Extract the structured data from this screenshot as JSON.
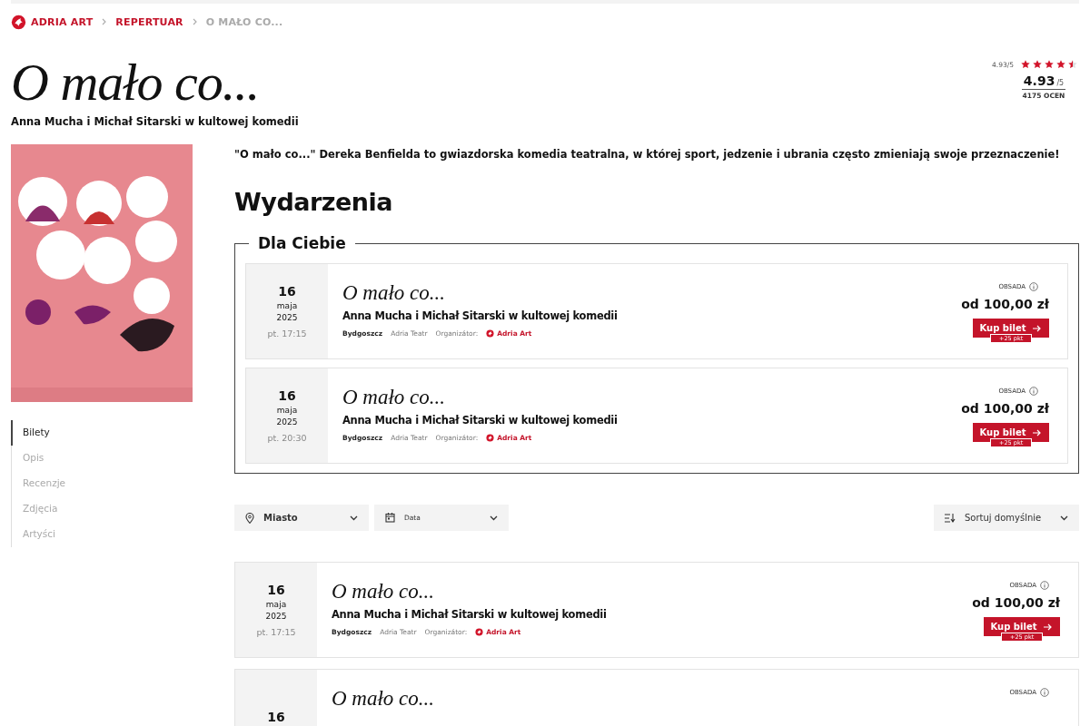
{
  "breadcrumb": [
    {
      "label": "ADRIA ART",
      "kind": "brand"
    },
    {
      "label": "REPERTUAR",
      "kind": "link"
    },
    {
      "label": "O MAŁO CO...",
      "kind": "current"
    }
  ],
  "title": "O mało co...",
  "subtitle": "Anna Mucha i Michał Sitarski w kultowej komedii",
  "rating": {
    "small": "4.93/5",
    "stars": 4.5,
    "value": "4.93",
    "out_of": "/5",
    "count": "4175 OCEN"
  },
  "side_nav": [
    {
      "label": "Bilety",
      "selected": true
    },
    {
      "label": "Opis",
      "selected": false
    },
    {
      "label": "Recenzje",
      "selected": false
    },
    {
      "label": "Zdjęcia",
      "selected": false
    },
    {
      "label": "Artyści",
      "selected": false
    }
  ],
  "description": "\"O mało co...\" Dereka Benfielda to gwiazdorska komedia teatralna, w której sport, jedzenie i ubrania często zmieniają swoje przeznaczenie!",
  "events_heading": "Wydarzenia",
  "for_you": {
    "legend": "Dla Ciebie",
    "events": [
      {
        "day": "16",
        "month": "maja",
        "year": "2025",
        "time": "pt. 17:15",
        "title": "O mało co...",
        "subtitle": "Anna Mucha i Michał Sitarski w kultowej komedii",
        "city": "Bydgoszcz",
        "venue": "Adria Teatr",
        "organizer_label": "Organizátor:",
        "organizer": "Adria Art",
        "cast_label": "OBSADA",
        "price": "od 100,00 zł",
        "button": "Kup bilet",
        "points": "+25 pkt"
      },
      {
        "day": "16",
        "month": "maja",
        "year": "2025",
        "time": "pt. 20:30",
        "title": "O mało co...",
        "subtitle": "Anna Mucha i Michał Sitarski w kultowej komedii",
        "city": "Bydgoszcz",
        "venue": "Adria Teatr",
        "organizer_label": "Organizátor:",
        "organizer": "Adria Art",
        "cast_label": "OBSADA",
        "price": "od 100,00 zł",
        "button": "Kup bilet",
        "points": "+25 pkt"
      }
    ]
  },
  "filters": {
    "city": "Miasto",
    "date": "Data",
    "sort": "Sortuj domyślnie"
  },
  "events": [
    {
      "day": "16",
      "month": "maja",
      "year": "2025",
      "time": "pt. 17:15",
      "title": "O mało co...",
      "subtitle": "Anna Mucha i Michał Sitarski w kultowej komedii",
      "city": "Bydgoszcz",
      "venue": "Adria Teatr",
      "organizer_label": "Organizátor:",
      "organizer": "Adria Art",
      "cast_label": "OBSADA",
      "price": "od 100,00 zł",
      "button": "Kup bilet",
      "points": "+25 pkt"
    },
    {
      "day": "16",
      "title": "O mało co...",
      "cast_label": "OBSADA"
    }
  ]
}
